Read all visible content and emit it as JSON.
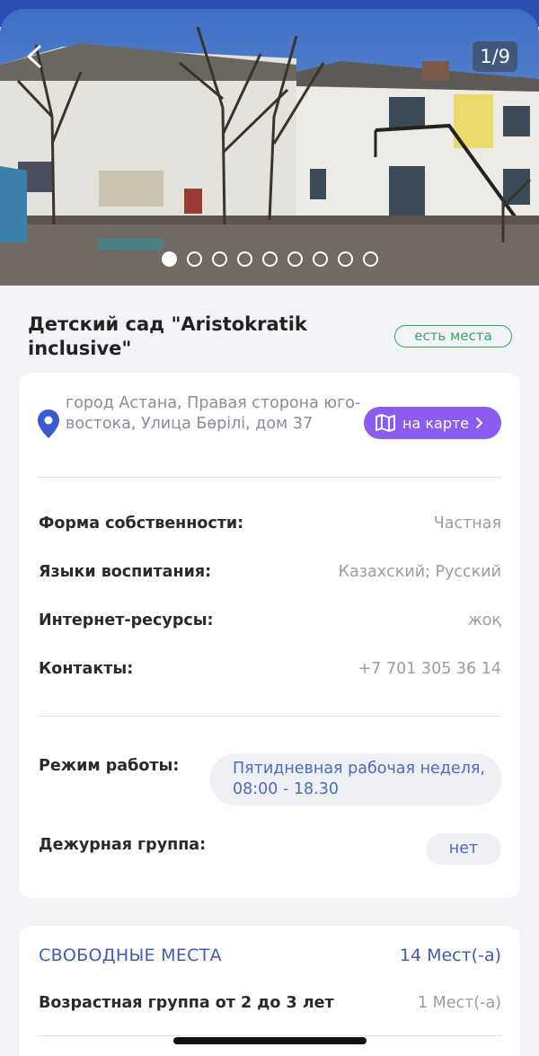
{
  "gallery": {
    "counter": "1/9",
    "total_images": 9,
    "current_image": 1
  },
  "header": {
    "title": "Детский сад \"Aristokratik inclusive\"",
    "availability_badge": "есть места"
  },
  "details": {
    "address": "город Астана, Правая сторона юго-востока, Улица Бөрілі, дом 37",
    "map_button_label": "на карте",
    "rows": [
      {
        "label": "Форма собственности:",
        "value": "Частная"
      },
      {
        "label": "Языки воспитания:",
        "value": "Казахский; Русский"
      },
      {
        "label": "Интернет-ресурсы:",
        "value": "жоқ"
      },
      {
        "label": "Контакты:",
        "value": "+7 701 305 36 14"
      }
    ],
    "schedule_label": "Режим работы:",
    "schedule_value": "Пятидневная рабочая неделя, 08:00 - 18.30",
    "duty_label": "Дежурная группа:",
    "duty_value": "нет"
  },
  "free_places": {
    "title": "СВОБОДНЫЕ МЕСТА",
    "total": "14 Мест(-а)",
    "groups": [
      {
        "label": "Возрастная группа от 2 до 3 лет",
        "value": "1 Мест(-а)"
      }
    ]
  },
  "colors": {
    "accent_blue": "#3e5cb3",
    "map_button": "#8a5cf0",
    "badge_green": "#39a464"
  },
  "icons": [
    "back-arrow-icon",
    "location-pin-icon",
    "map-icon",
    "chevron-right-icon"
  ]
}
